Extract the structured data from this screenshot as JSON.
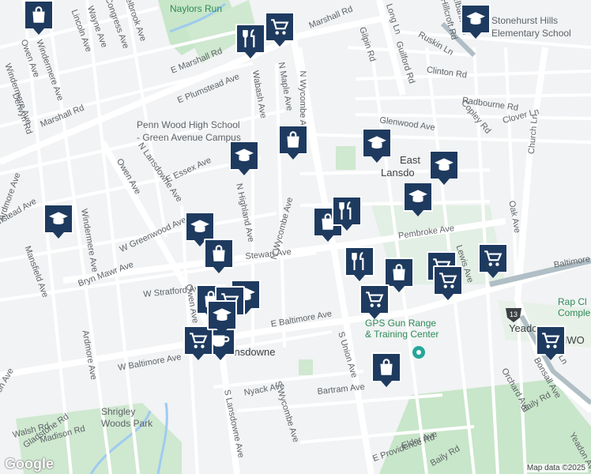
{
  "map": {
    "attribution": "Map data ©2025",
    "logo": "Google",
    "places": [
      {
        "text": "Penn Wood High School"
      },
      {
        "text": "- Green Avenue Campus"
      },
      {
        "text": "Stonehurst Hills"
      },
      {
        "text": "Elementary School"
      },
      {
        "text": "GPS Gun Range"
      },
      {
        "text": "& Training Center"
      },
      {
        "text": "Shrigley"
      },
      {
        "text": "Woods Park"
      },
      {
        "text": "Naylors Run"
      },
      {
        "text": "Rap Cl"
      },
      {
        "text": "Comple"
      },
      {
        "text": "East"
      },
      {
        "text": "Lansdo"
      },
      {
        "text": "Lansdowne"
      },
      {
        "text": "Yeadon"
      },
      {
        "text": "NWO"
      }
    ],
    "streets": [
      {
        "text": "Marshall Rd"
      },
      {
        "text": "Marshall Rd"
      },
      {
        "text": "E Marshall Rd"
      },
      {
        "text": "E Plumstead Ave"
      },
      {
        "text": "Glenwood Ave"
      },
      {
        "text": "Pembroke Ave"
      },
      {
        "text": "Stewart Ave"
      },
      {
        "text": "W Stratford Ave"
      },
      {
        "text": "E Baltimore Ave"
      },
      {
        "text": "W Baltimore Ave"
      },
      {
        "text": "Baltimore Ave"
      },
      {
        "text": "Nyack Ave"
      },
      {
        "text": "Bartram Ave"
      },
      {
        "text": "Baily Rd"
      },
      {
        "text": "Baily Rd"
      },
      {
        "text": "E Providence Rd"
      },
      {
        "text": "Elder Ave"
      },
      {
        "text": "N Wycombe Ave"
      },
      {
        "text": "N Wycombe Ave"
      },
      {
        "text": "S Wycombe Ave"
      },
      {
        "text": "S Union Ave"
      },
      {
        "text": "S Lansdowne Ave"
      },
      {
        "text": "N Lansdowne Ave"
      },
      {
        "text": "N Highland Ave"
      },
      {
        "text": "Owen Ave"
      },
      {
        "text": "Owen Ave"
      },
      {
        "text": "Windermere Ave"
      },
      {
        "text": "Windermere Ave"
      },
      {
        "text": "Ardmore Ave"
      },
      {
        "text": "Ardmore Ave"
      },
      {
        "text": "Mansfield Ave"
      },
      {
        "text": "Bryn Mawr Ave"
      },
      {
        "text": "W Greenwood Ave"
      },
      {
        "text": "E Essex Ave"
      },
      {
        "text": "Wabash Ave"
      },
      {
        "text": "N Maple Ave"
      },
      {
        "text": "Long Ln"
      },
      {
        "text": "Gilpin Rd"
      },
      {
        "text": "Guilford Rd"
      },
      {
        "text": "Ruskin Ln"
      },
      {
        "text": "Clinton Rd"
      },
      {
        "text": "Radbourne Rd"
      },
      {
        "text": "Clover Ln"
      },
      {
        "text": "Copley Rd"
      },
      {
        "text": "Church Ln"
      },
      {
        "text": "Church Ln"
      },
      {
        "text": "Oak Ave"
      },
      {
        "text": "Lewis Ave"
      },
      {
        "text": "Orchard Ave"
      },
      {
        "text": "Bonsall Ave"
      },
      {
        "text": "Yeadon Ave"
      },
      {
        "text": "Congress Ave"
      },
      {
        "text": "Wayne Ave"
      },
      {
        "text": "Lincoln Ave"
      },
      {
        "text": "Derwyn Rd"
      },
      {
        "text": "Walsh Rd"
      },
      {
        "text": "Gladstone Rd"
      },
      {
        "text": "Madison Rd"
      },
      {
        "text": "Eldon Ave"
      },
      {
        "text": "Drexelbrook Ave"
      },
      {
        "text": "Elbank Rd"
      },
      {
        "text": "Hillcroft Rd"
      },
      {
        "text": "Owen Ave"
      },
      {
        "text": "Plumstead Ave"
      },
      {
        "text": "Windermere Ave"
      }
    ],
    "route_badge": "13",
    "markers": [
      {
        "type": "bag"
      },
      {
        "type": "cart"
      },
      {
        "type": "school"
      },
      {
        "type": "fork"
      },
      {
        "type": "school"
      },
      {
        "type": "bag"
      },
      {
        "type": "school"
      },
      {
        "type": "school"
      },
      {
        "type": "school"
      },
      {
        "type": "bag"
      },
      {
        "type": "fork"
      },
      {
        "type": "school"
      },
      {
        "type": "school"
      },
      {
        "type": "bag"
      },
      {
        "type": "fork"
      },
      {
        "type": "bag"
      },
      {
        "type": "cart"
      },
      {
        "type": "cart"
      },
      {
        "type": "cart"
      },
      {
        "type": "cart"
      },
      {
        "type": "school"
      },
      {
        "type": "bag"
      },
      {
        "type": "cart"
      },
      {
        "type": "cup"
      },
      {
        "type": "bag"
      },
      {
        "type": "cart"
      },
      {
        "type": "cart"
      },
      {
        "type": "school"
      }
    ]
  }
}
